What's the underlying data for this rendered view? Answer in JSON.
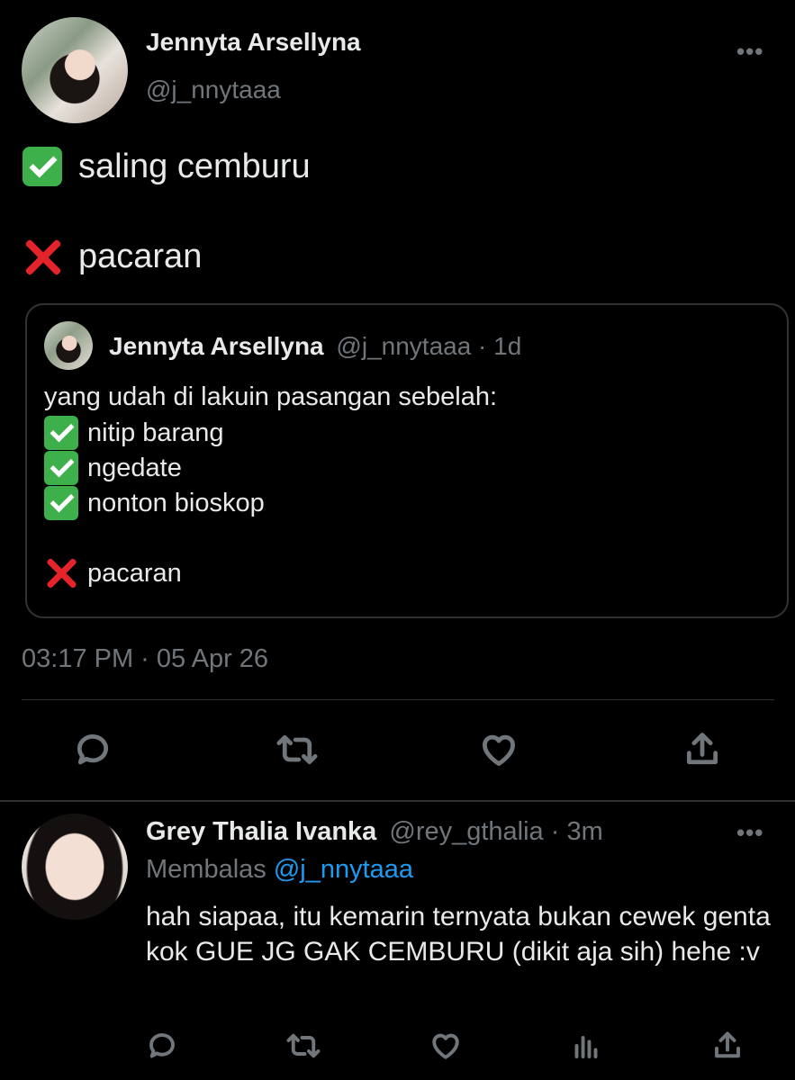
{
  "main_tweet": {
    "author_name": "Jennyta Arsellyna",
    "author_handle": "@j_nnytaaa",
    "more_label": "•••",
    "line1": "saling cemburu",
    "line2": "pacaran",
    "timestamp": "03:17 PM · 05 Apr 26",
    "quoted": {
      "author_name": "Jennyta Arsellyna",
      "meta": "@j_nnytaaa · 1d",
      "intro": "yang udah di lakuin pasangan sebelah:",
      "items": [
        "nitip barang",
        "ngedate",
        "nonton bioskop"
      ],
      "last": "pacaran"
    },
    "actions": [
      "reply-icon",
      "retweet-icon",
      "like-icon",
      "share-icon"
    ]
  },
  "reply_tweet": {
    "author_name": "Grey Thalia Ivanka",
    "meta": "@rey_gthalia · 3m",
    "more_label": "•••",
    "replying_label": "Membalas",
    "replying_to": "@j_nnytaaa",
    "text": "hah siapaa, itu kemarin ternyata bukan cewek genta kok GUE JG GAK CEMBURU (dikit aja sih) hehe :v",
    "actions": [
      "reply-icon",
      "retweet-icon",
      "like-icon",
      "analytics-icon",
      "share-icon"
    ]
  },
  "colors": {
    "background": "#000000",
    "text": "#e7e9ea",
    "muted": "#71767b",
    "link": "#1d9bf0",
    "border": "#2f3336"
  }
}
